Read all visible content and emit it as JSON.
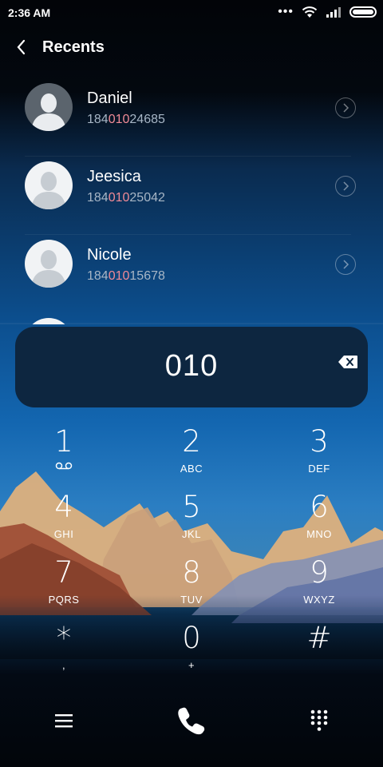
{
  "status_bar": {
    "time": "2:36 AM",
    "more": "•••"
  },
  "header": {
    "title": "Recents"
  },
  "contacts": [
    {
      "name": "Daniel",
      "number_prefix": "184",
      "number_match": "010",
      "number_suffix": "24685"
    },
    {
      "name": "Jeesica",
      "number_prefix": "184",
      "number_match": "010",
      "number_suffix": "25042"
    },
    {
      "name": "Nicole",
      "number_prefix": "184",
      "number_match": "010",
      "number_suffix": "15678"
    }
  ],
  "dialer": {
    "entered_number": "010"
  },
  "keypad": {
    "k1": {
      "digit": "1",
      "letters": ""
    },
    "k2": {
      "digit": "2",
      "letters": "ABC"
    },
    "k3": {
      "digit": "3",
      "letters": "DEF"
    },
    "k4": {
      "digit": "4",
      "letters": "GHI"
    },
    "k5": {
      "digit": "5",
      "letters": "JKL"
    },
    "k6": {
      "digit": "6",
      "letters": "MNO"
    },
    "k7": {
      "digit": "7",
      "letters": "PQRS"
    },
    "k8": {
      "digit": "8",
      "letters": "TUV"
    },
    "k9": {
      "digit": "9",
      "letters": "WXYZ"
    },
    "kstar": {
      "digit": "*",
      "letters": ","
    },
    "k0": {
      "digit": "0",
      "letters": "+"
    },
    "khash": {
      "digit": "#",
      "letters": ""
    }
  },
  "colors": {
    "match_highlight": "#f08a96",
    "display_bg": "#0d2640",
    "accent": "#ffffff"
  },
  "icons": {
    "back": "chevron-left-icon",
    "backspace": "backspace-icon",
    "voicemail": "voicemail-icon",
    "menu": "menu-icon",
    "call": "phone-icon",
    "dialpad": "dialpad-icon"
  }
}
